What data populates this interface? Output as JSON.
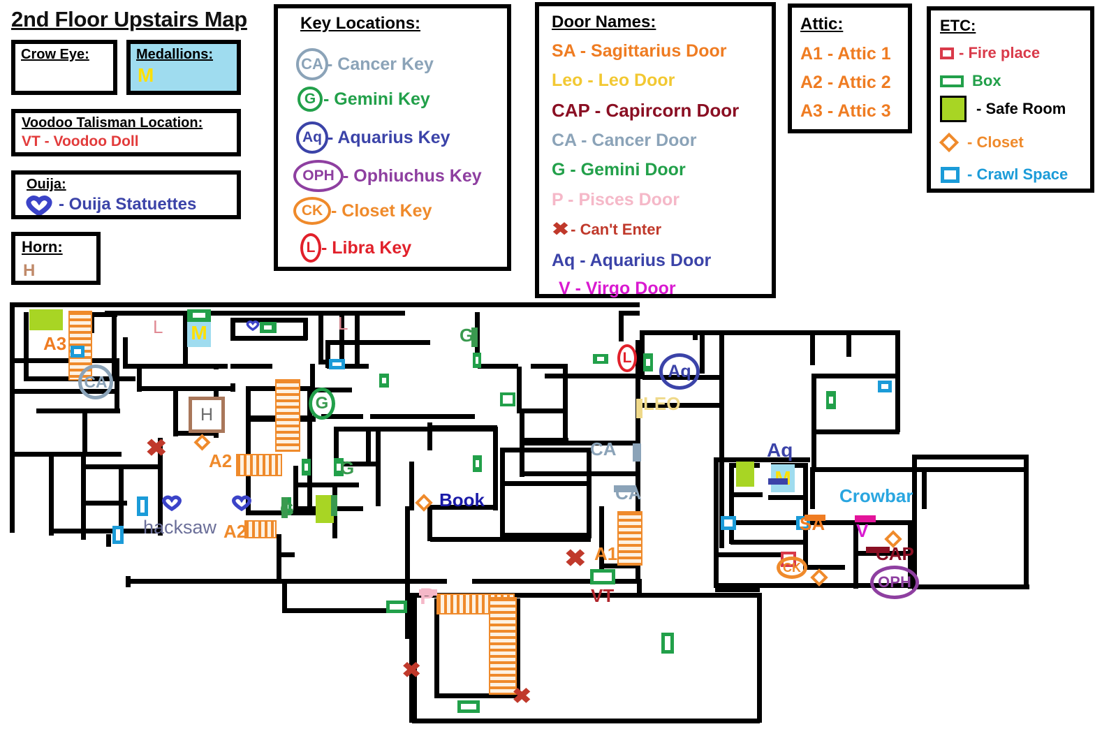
{
  "page": {
    "title": "2nd Floor Upstairs Map"
  },
  "panels": {
    "crow_eye": {
      "header": "Crow Eye:",
      "icon": "crow-eye-star-icon"
    },
    "medallions": {
      "header": "Medallions:",
      "symbol": "M"
    },
    "voodoo": {
      "header": "Voodoo Talisman Location:",
      "entry": "VT - Voodoo Doll"
    },
    "ouija": {
      "header": "Ouija:",
      "entry": "- Ouija Statuettes",
      "icon": "ouija-heart-icon"
    },
    "horn": {
      "header": "Horn:",
      "symbol": "H"
    },
    "key_locations": {
      "header": "Key Locations:",
      "items": [
        {
          "tag": "CA",
          "label": "- Cancer Key",
          "color": "#8ba3b8"
        },
        {
          "tag": "G",
          "label": "- Gemini Key",
          "color": "#22a04a"
        },
        {
          "tag": "Aq",
          "label": "- Aquarius Key",
          "color": "#3b43a8"
        },
        {
          "tag": "OPH",
          "label": "- Ophiuchus Key",
          "color": "#8e3fa0"
        },
        {
          "tag": "CK",
          "label": "- Closet Key",
          "color": "#ef8a2b"
        },
        {
          "tag": "L",
          "label": "- Libra Key",
          "color": "#e1202a"
        }
      ]
    },
    "door_names": {
      "header": "Door Names:",
      "items": [
        {
          "text": "SA - Sagittarius Door",
          "color": "#ef7c22"
        },
        {
          "text": "Leo - Leo Door",
          "color": "#f2c832"
        },
        {
          "text": "CAP - Capircorn Door",
          "color": "#8a0f23"
        },
        {
          "text": "CA - Cancer Door",
          "color": "#8ba3b8"
        },
        {
          "text": "G - Gemini Door",
          "color": "#22a04a"
        },
        {
          "text": "P - Pisces Door",
          "color": "#f5b8c8"
        },
        {
          "text": "- Can't Enter",
          "color": "#c0392b",
          "icon": "x-mark-icon"
        },
        {
          "text": "Aq - Aquarius Door",
          "color": "#3b43a8"
        },
        {
          "text": "V - Virgo Door",
          "color": "#d91ad0"
        }
      ]
    },
    "attic": {
      "header": "Attic:",
      "items": [
        "A1 - Attic 1",
        "A2 - Attic 2",
        "A3 - Attic 3"
      ],
      "color": "#ef7c22"
    },
    "etc": {
      "header": "ETC:",
      "items": [
        {
          "label": "- Fire place",
          "color": "#d93a4a",
          "icon": "fireplace-icon"
        },
        {
          "label": "Box",
          "color": "#22a04a",
          "icon": "box-icon"
        },
        {
          "label": "- Safe Room",
          "color": "#000000",
          "icon": "safe-room-icon"
        },
        {
          "label": "- Closet",
          "color": "#ef8a2b",
          "icon": "closet-diamond-icon"
        },
        {
          "label": "- Crawl Space",
          "color": "#1b9bd8",
          "icon": "crawl-space-icon"
        }
      ]
    }
  },
  "map": {
    "labels": [
      {
        "id": "attic3",
        "text": "A3",
        "color": "#ef7c22",
        "size": 26
      },
      {
        "id": "libra-nw",
        "text": "L",
        "color": "#e08a94",
        "size": 26
      },
      {
        "id": "medal-nw",
        "text": "M",
        "color": "#ffe000",
        "size": 28
      },
      {
        "id": "libra-n",
        "text": "L",
        "color": "#e08a94",
        "size": 26
      },
      {
        "id": "gem-n",
        "text": "G",
        "color": "#3a9a4f",
        "size": 26
      },
      {
        "id": "horn",
        "text": "H",
        "color": "#6b6b6b",
        "size": 26
      },
      {
        "id": "attic2-a",
        "text": "A2",
        "color": "#ef8a2b",
        "size": 26
      },
      {
        "id": "attic2-b",
        "text": "A2",
        "color": "#ef8a2b",
        "size": 26
      },
      {
        "id": "hacksaw",
        "text": "hacksaw",
        "color": "#6b6f99",
        "size": 27
      },
      {
        "id": "gem-mid",
        "text": "G",
        "color": "#3a9a4f",
        "size": 26
      },
      {
        "id": "gem-mid2",
        "text": "G",
        "color": "#3a9a4f",
        "size": 26
      },
      {
        "id": "book",
        "text": "Book",
        "color": "#1a1aa8",
        "size": 26
      },
      {
        "id": "leo",
        "text": "LEO",
        "color": "#efd98a",
        "size": 26
      },
      {
        "id": "cancer-a",
        "text": "CA",
        "color": "#8ba3b8",
        "size": 26
      },
      {
        "id": "cancer-b",
        "text": "CA",
        "color": "#8ba3b8",
        "size": 26
      },
      {
        "id": "aquar-r",
        "text": "Aq",
        "color": "#3b43a8",
        "size": 28
      },
      {
        "id": "attic1",
        "text": "A1",
        "color": "#ef8a2b",
        "size": 26
      },
      {
        "id": "voodoo",
        "text": "VT",
        "color": "#b0252c",
        "size": 26
      },
      {
        "id": "pisces",
        "text": "P",
        "color": "#f5b8c8",
        "size": 30
      },
      {
        "id": "medal-r",
        "text": "M",
        "color": "#ffe000",
        "size": 28
      },
      {
        "id": "sagit",
        "text": "SA",
        "color": "#ef7c22",
        "size": 26
      },
      {
        "id": "crowbar",
        "text": "Crowbar",
        "color": "#2aa6e0",
        "size": 26
      },
      {
        "id": "virgo",
        "text": "V",
        "color": "#d91ad0",
        "size": 26
      },
      {
        "id": "capricorn",
        "text": "CAP",
        "color": "#8a0f23",
        "size": 26
      }
    ],
    "key_markers": [
      {
        "id": "cancer-key",
        "tag": "CA",
        "color": "#8ba3b8"
      },
      {
        "id": "gemini-key",
        "tag": "G",
        "color": "#22a04a"
      },
      {
        "id": "libra-key",
        "tag": "L",
        "color": "#e1202a"
      },
      {
        "id": "aquarius-key",
        "tag": "Aq",
        "color": "#3b43a8"
      },
      {
        "id": "closet-key",
        "tag": "CK",
        "color": "#ef8a2b"
      },
      {
        "id": "ophiuchus-key",
        "tag": "OPH",
        "color": "#8e3fa0"
      }
    ]
  }
}
